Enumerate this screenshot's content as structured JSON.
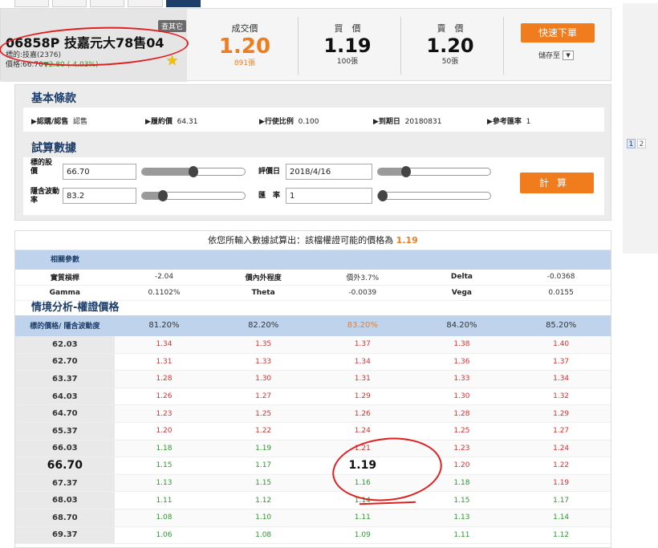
{
  "colors": {
    "accent": "#f07c1e",
    "navy": "#1d3e6b",
    "up": "#d93030",
    "down": "#2b9a2b"
  },
  "quote": {
    "tag": "查其它",
    "title": "06858P 技嘉元大78售04",
    "underlying": "標的:技嘉(2376)",
    "price_label": "價格:66.70",
    "price_change": "▼2.80 (-4.03%)",
    "last_label": "成交價",
    "last_value": "1.20",
    "last_volume": "891張",
    "bid_label": "買　價",
    "bid_value": "1.19",
    "bid_volume": "100張",
    "ask_label": "賣　價",
    "ask_value": "1.20",
    "ask_volume": "50張",
    "quick_order": "快速下單",
    "save_to": "儲存至"
  },
  "pager": [
    "1",
    "2"
  ],
  "basic": {
    "title": "基本條款",
    "items": [
      {
        "label": "▶認購/認售",
        "value": "認售"
      },
      {
        "label": "▶履約價",
        "value": "64.31"
      },
      {
        "label": "▶行使比例",
        "value": "0.100"
      },
      {
        "label": "▶到期日",
        "value": "20180831"
      },
      {
        "label": "▶參考匯率",
        "value": "1"
      }
    ]
  },
  "calc": {
    "title": "試算數據",
    "underlying_price_label": "標的股價",
    "underlying_price": "66.70",
    "eval_date_label": "評價日",
    "eval_date": "2018/4/16",
    "implied_vol_label": "隱含波動率",
    "implied_vol": "83.2",
    "fx_label": "匯　率",
    "fx": "1",
    "calc_button": "計算",
    "slider_levels": {
      "price": 0.5,
      "date": 0.25,
      "vol": 0.2,
      "fx": 0.0
    }
  },
  "result": {
    "message_prefix": "依您所輸入數據試算出：該檔權證可能的價格為",
    "message_value": "1.19",
    "params_title": "相關參數",
    "params": [
      [
        "實質槓桿",
        "-2.04",
        "價內外程度",
        "價外3.7%",
        "Delta",
        "-0.0368"
      ],
      [
        "Gamma",
        "0.1102%",
        "Theta",
        "-0.0039",
        "Vega",
        "0.0155"
      ]
    ],
    "scenario_title": "情境分析-權證價格",
    "scenario_corner": "標的價格/ 隱含波動度",
    "vols": [
      "81.20%",
      "82.20%",
      "83.20%",
      "84.20%",
      "85.20%"
    ],
    "rows": [
      {
        "price": "62.03",
        "vals": [
          "1.34",
          "1.35",
          "1.37",
          "1.38",
          "1.40"
        ],
        "dir": "up"
      },
      {
        "price": "62.70",
        "vals": [
          "1.31",
          "1.33",
          "1.34",
          "1.36",
          "1.37"
        ],
        "dir": "up"
      },
      {
        "price": "63.37",
        "vals": [
          "1.28",
          "1.30",
          "1.31",
          "1.33",
          "1.34"
        ],
        "dir": "up"
      },
      {
        "price": "64.03",
        "vals": [
          "1.26",
          "1.27",
          "1.29",
          "1.30",
          "1.32"
        ],
        "dir": "up"
      },
      {
        "price": "64.70",
        "vals": [
          "1.23",
          "1.25",
          "1.26",
          "1.28",
          "1.29"
        ],
        "dir": "up"
      },
      {
        "price": "65.37",
        "vals": [
          "1.20",
          "1.22",
          "1.24",
          "1.25",
          "1.27"
        ],
        "dir": "up"
      },
      {
        "price": "66.03",
        "vals": [
          "1.18",
          "1.19",
          "1.21",
          "1.23",
          "1.24"
        ],
        "dir": "mixed"
      },
      {
        "price": "66.70",
        "vals": [
          "1.15",
          "1.17",
          "1.19",
          "1.20",
          "1.22"
        ],
        "dir": "mixed",
        "current": true
      },
      {
        "price": "67.37",
        "vals": [
          "1.13",
          "1.15",
          "1.16",
          "1.18",
          "1.19"
        ],
        "dir": "mixed"
      },
      {
        "price": "68.03",
        "vals": [
          "1.11",
          "1.12",
          "1.14",
          "1.15",
          "1.17"
        ],
        "dir": "dn"
      },
      {
        "price": "68.70",
        "vals": [
          "1.08",
          "1.10",
          "1.11",
          "1.13",
          "1.14"
        ],
        "dir": "dn"
      },
      {
        "price": "69.37",
        "vals": [
          "1.06",
          "1.08",
          "1.09",
          "1.11",
          "1.12"
        ],
        "dir": "dn"
      }
    ]
  }
}
